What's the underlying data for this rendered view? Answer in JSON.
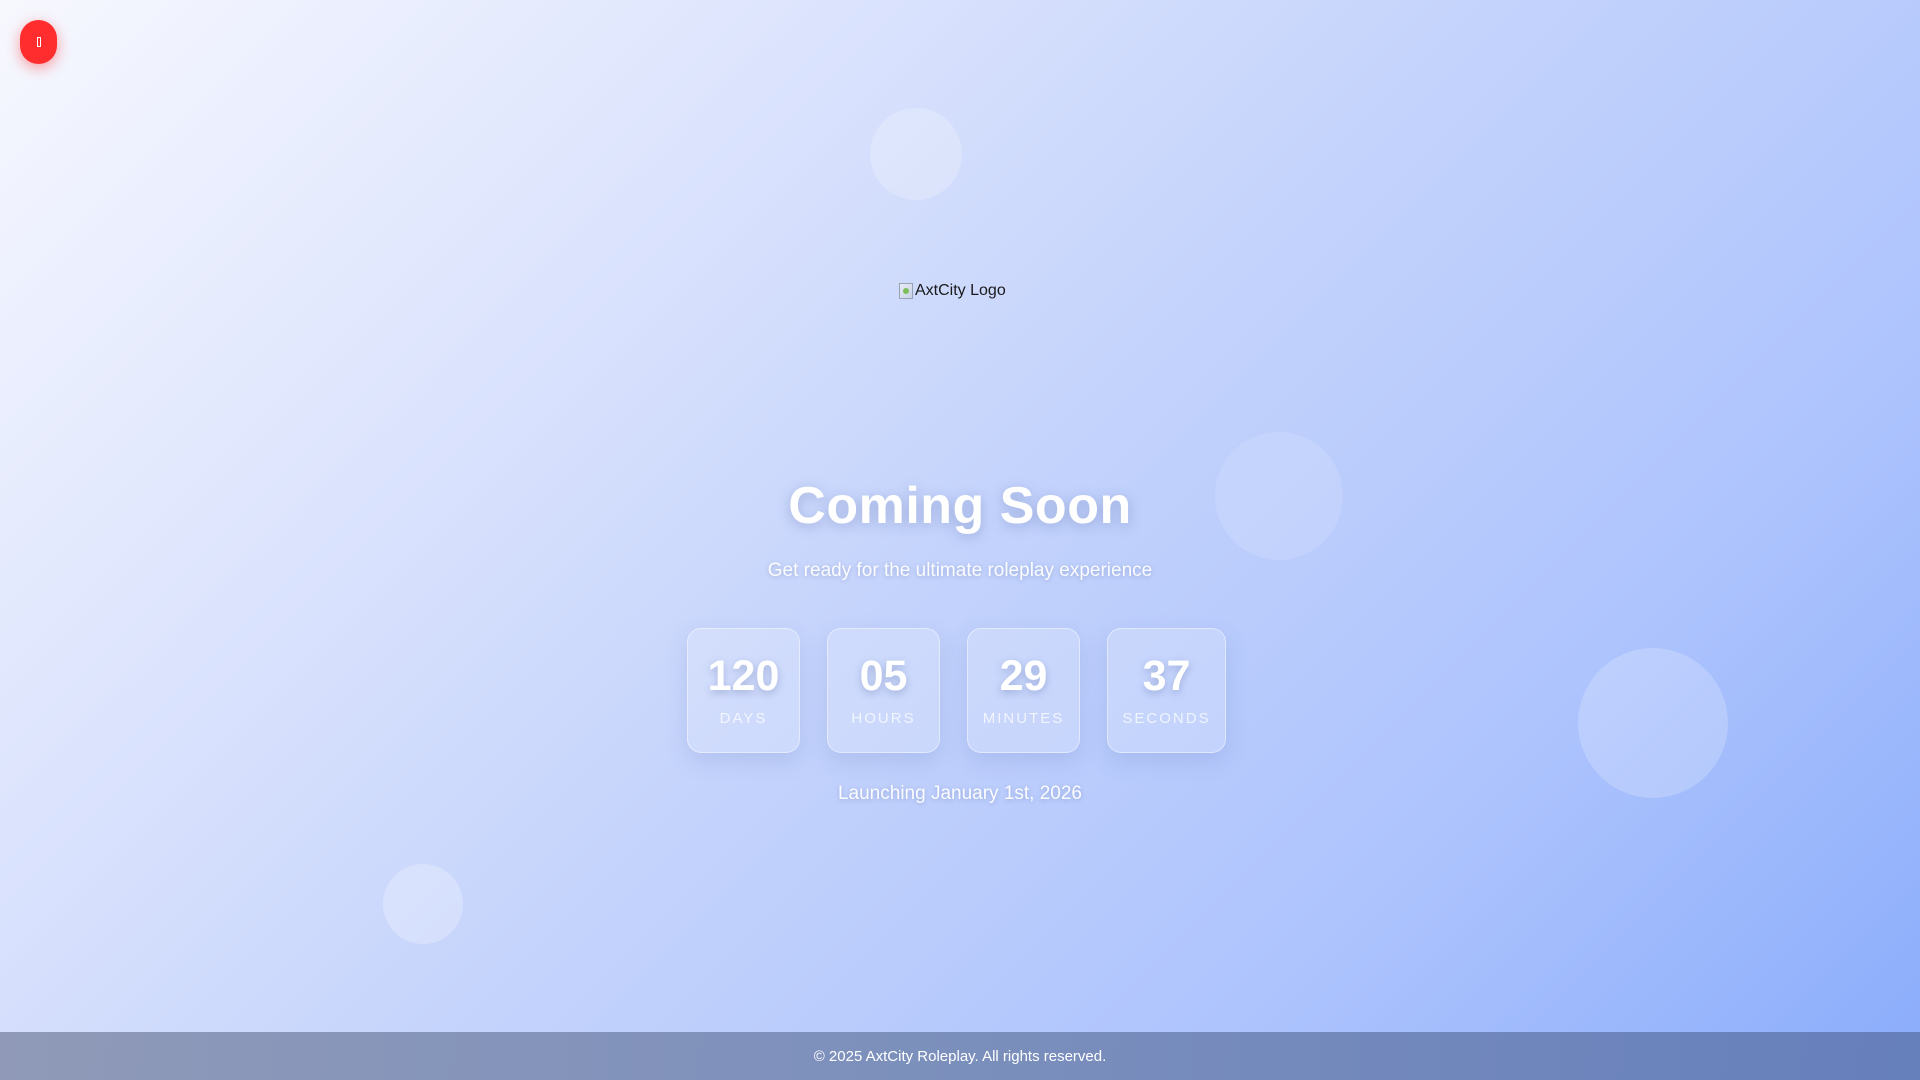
{
  "audio_toggle": {
    "icon": "music-icon",
    "color": "#ff2d2d"
  },
  "logo": {
    "alt_text": "AxtCity Logo",
    "icon": "broken-image-icon"
  },
  "hero": {
    "title": "Coming Soon",
    "subtitle": "Get ready for the ultimate roleplay experience"
  },
  "countdown": {
    "days": {
      "value": "120",
      "label": "DAYS"
    },
    "hours": {
      "value": "05",
      "label": "HOURS"
    },
    "minutes": {
      "value": "29",
      "label": "MINUTES"
    },
    "seconds": {
      "value": "37",
      "label": "SECONDS"
    }
  },
  "launch_text": "Launching January 1st, 2026",
  "footer": {
    "copyright": "© 2025 AxtCity Roleplay. All rights reserved."
  },
  "colors": {
    "background_start": "#f7f8fe",
    "background_end": "#8aacfb",
    "text": "#ffffff"
  }
}
